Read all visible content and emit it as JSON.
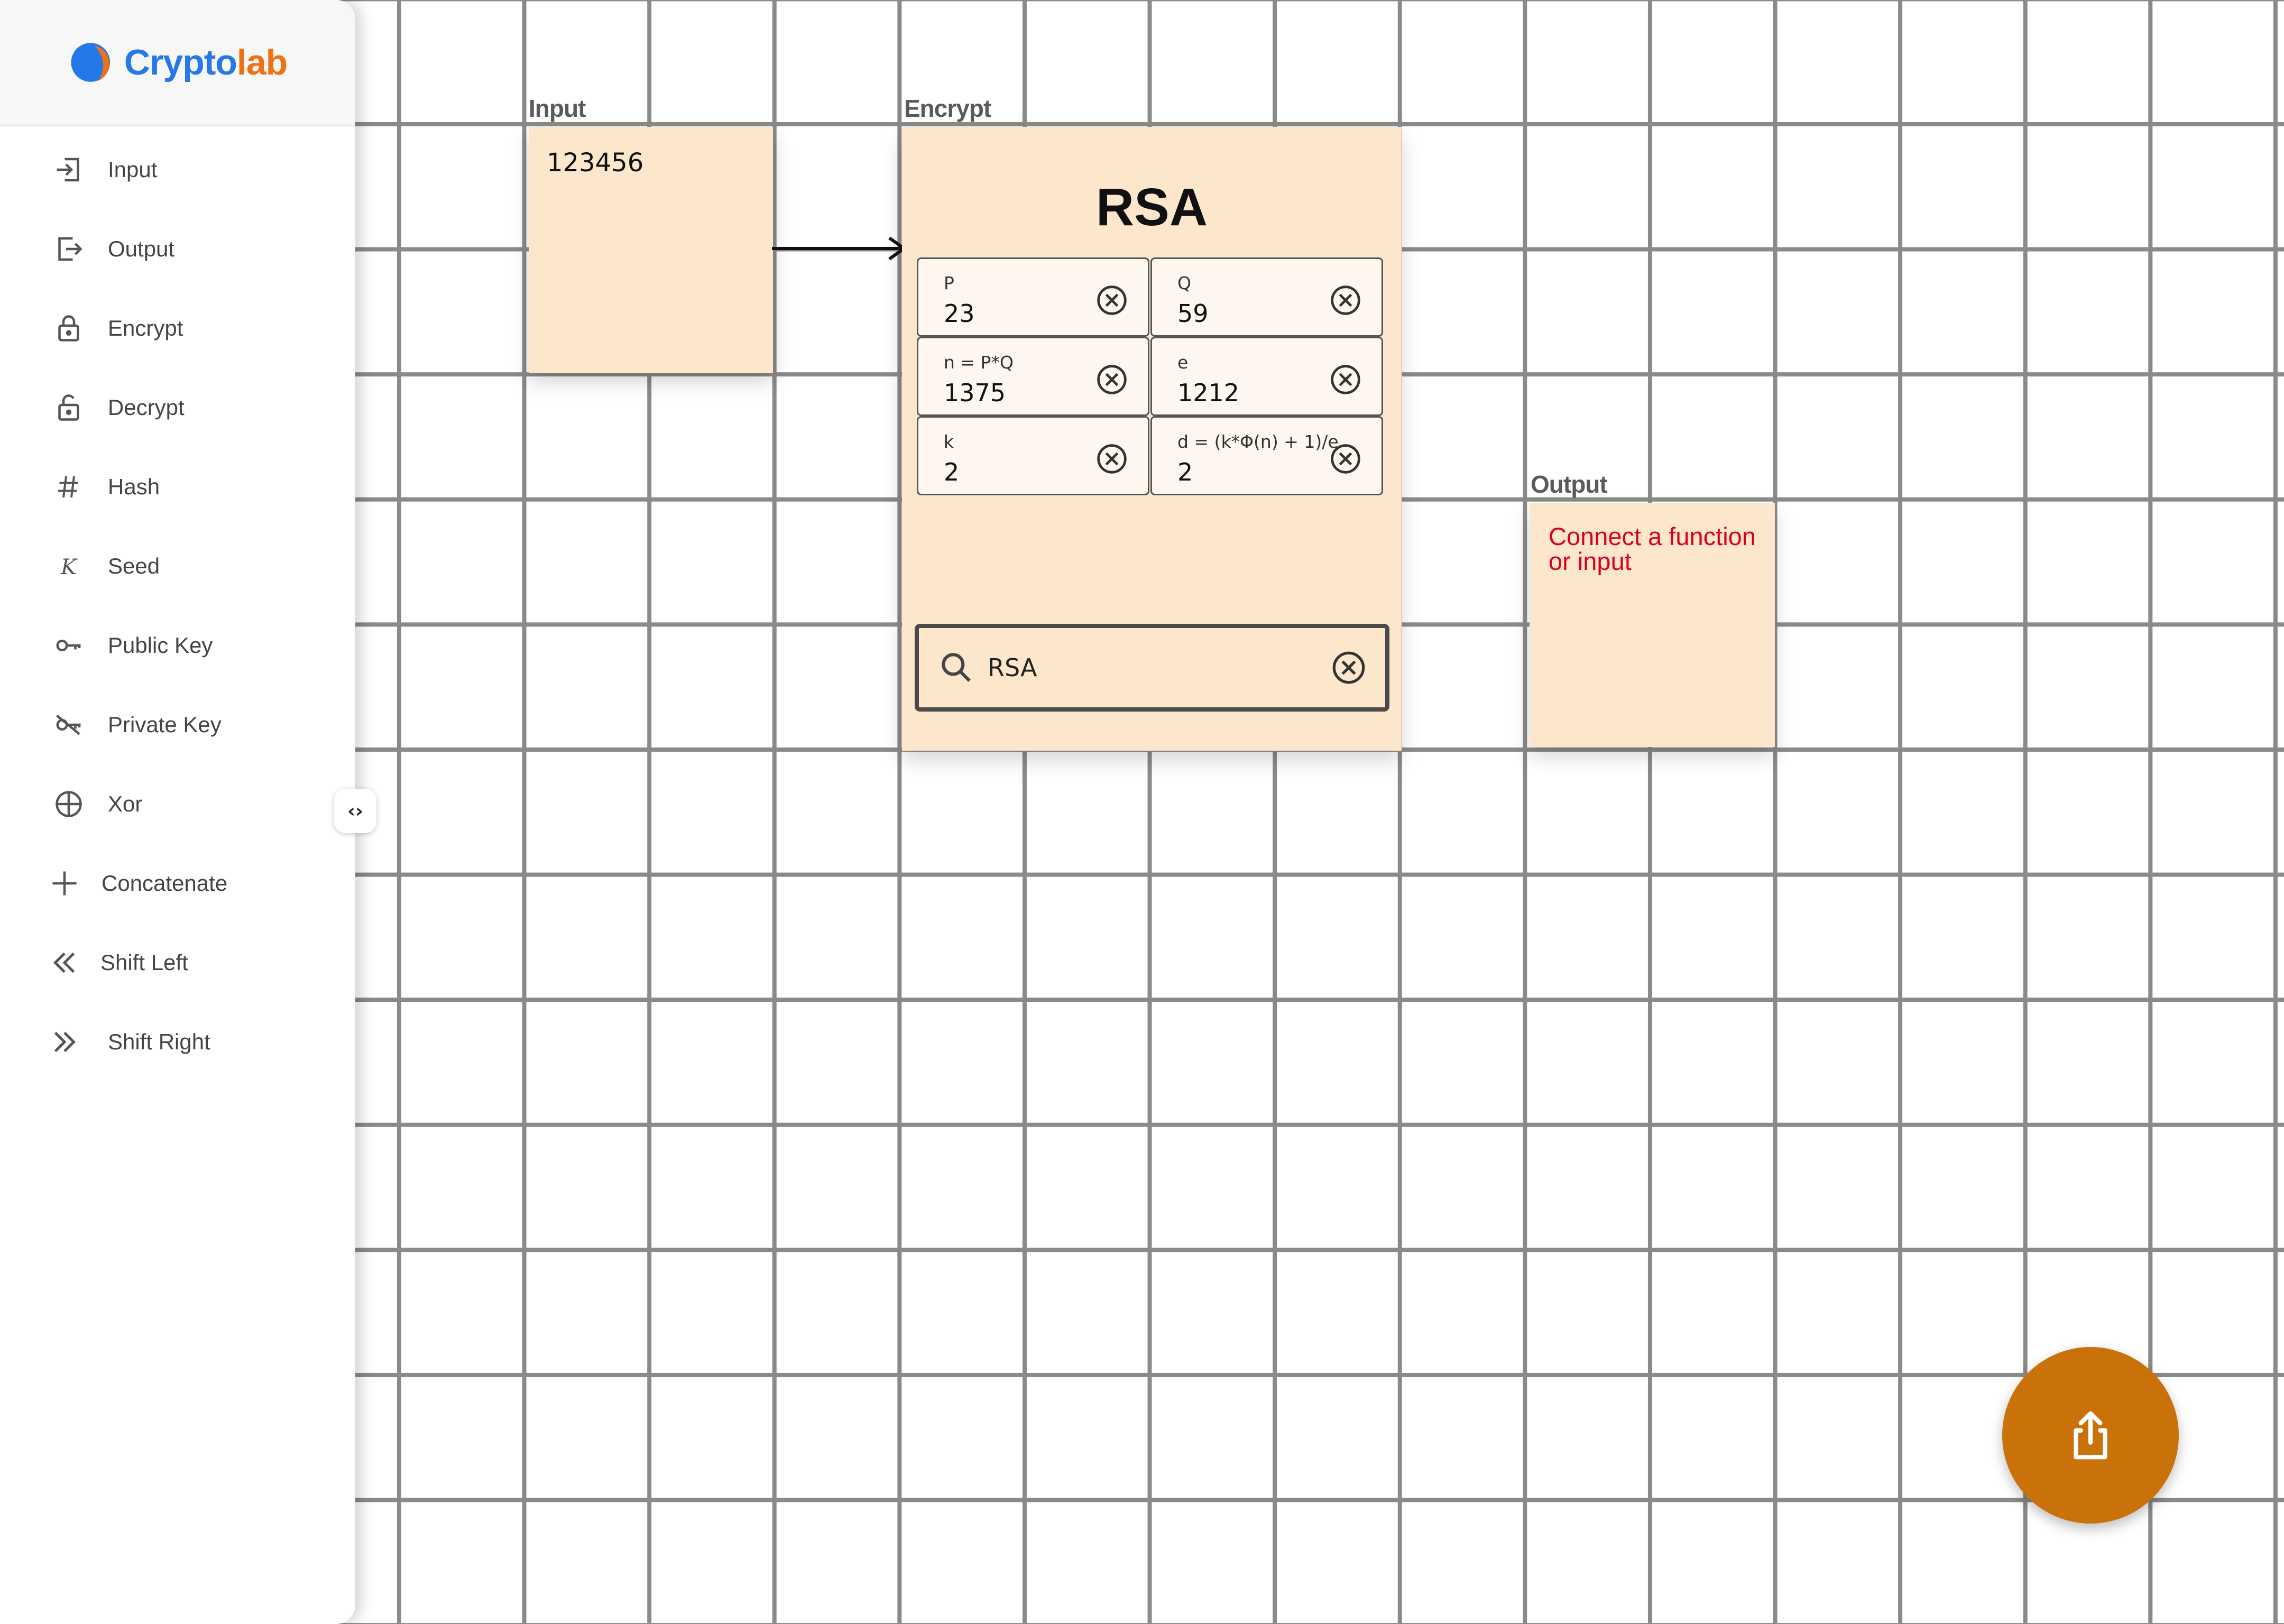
{
  "app": {
    "brand_part1": "Crypto",
    "brand_part2": "lab",
    "brand_colors": {
      "primary": "#2478e8",
      "secondary": "#f07114"
    }
  },
  "sidebar": {
    "items": [
      {
        "label": "Input",
        "icon": "sign-in-icon"
      },
      {
        "label": "Output",
        "icon": "sign-out-icon"
      },
      {
        "label": "Encrypt",
        "icon": "lock-icon"
      },
      {
        "label": "Decrypt",
        "icon": "unlock-icon"
      },
      {
        "label": "Hash",
        "icon": "hash-icon"
      },
      {
        "label": "Seed",
        "icon": "k-icon"
      },
      {
        "label": "Public Key",
        "icon": "key-icon"
      },
      {
        "label": "Private Key",
        "icon": "key-slash-icon"
      },
      {
        "label": "Xor",
        "icon": "xor-icon"
      },
      {
        "label": "Concatenate",
        "icon": "plus-icon"
      },
      {
        "label": "Shift Left",
        "icon": "double-chevron-left-icon"
      },
      {
        "label": "Shift Right",
        "icon": "double-chevron-right-icon"
      }
    ],
    "collapse_glyph": "‹›"
  },
  "canvas": {
    "input_node": {
      "label": "Input",
      "value": "123456"
    },
    "encrypt_node": {
      "label": "Encrypt",
      "title": "RSA",
      "params": [
        {
          "label": "P",
          "value": "23"
        },
        {
          "label": "Q",
          "value": "59"
        },
        {
          "label": "n = P*Q",
          "value": "1375"
        },
        {
          "label": "e",
          "value": "1212"
        },
        {
          "label": "k",
          "value": "2"
        },
        {
          "label": "d = (k*Φ(n) + 1)/e",
          "value": "2"
        }
      ],
      "search_value": "RSA"
    },
    "output_node": {
      "label": "Output",
      "message": "Connect a function or input"
    }
  },
  "colors": {
    "node_bg": "#fde7cc",
    "fab": "#c9720a",
    "error_text": "#d9001b",
    "grid": "#8a8a8a"
  }
}
